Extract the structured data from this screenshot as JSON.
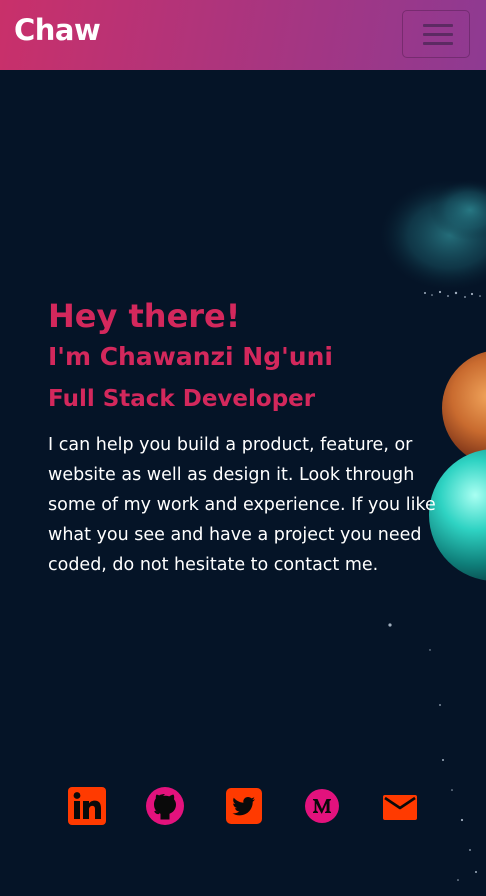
{
  "navbar": {
    "brand": "Chaw",
    "menu_icon": "hamburger-icon"
  },
  "hero": {
    "greeting": "Hey there!",
    "name": "I'm Chawanzi Ng'uni",
    "role": "Full Stack Developer",
    "intro": "I can help you build a product, feature, or website as well as design it. Look through some of my work and experience. If you like what you see and have a project you need coded, do not hesitate to contact me."
  },
  "social": {
    "icons": [
      "linkedin-icon",
      "github-icon",
      "twitter-icon",
      "medium-icon",
      "email-icon"
    ]
  },
  "colors": {
    "background": "#051427",
    "accent": "#d3285c",
    "navbar_start": "#c9306a",
    "navbar_end": "#8e3a92",
    "social_orange": "#ff3a00",
    "social_pink": "#e3127d"
  }
}
